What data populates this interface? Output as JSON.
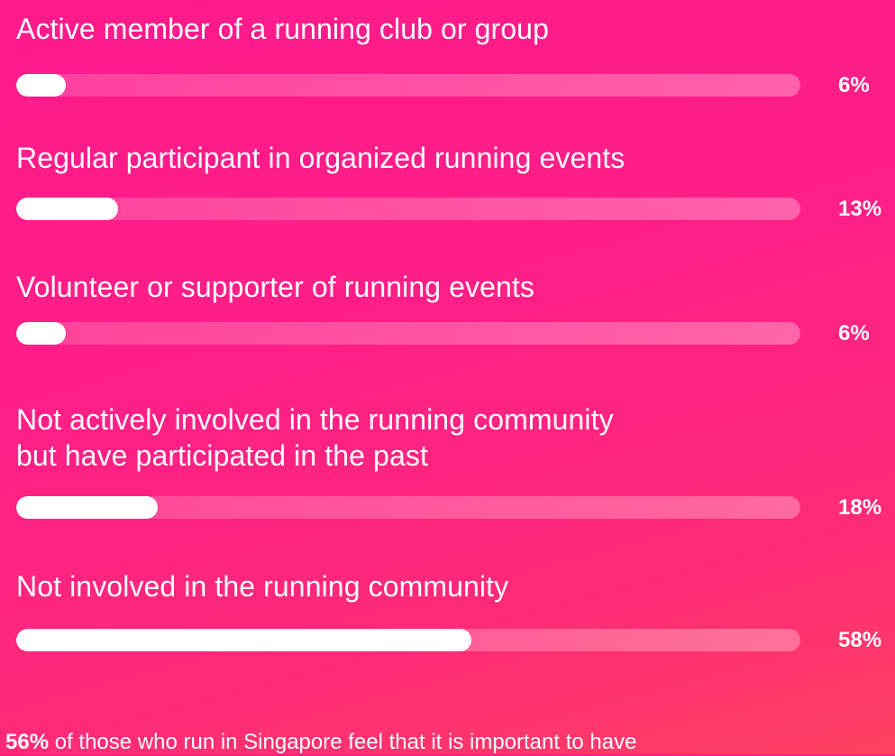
{
  "chart_data": {
    "type": "bar",
    "orientation": "horizontal",
    "xlim": [
      0,
      100
    ],
    "categories": [
      "Active member of a running club or group",
      "Regular participant in organized running events",
      "Volunteer or supporter of running events",
      "Not actively involved in the running community but have participated in the past",
      "Not involved in the running community"
    ],
    "category_lines": [
      [
        "Active member of a running club or group"
      ],
      [
        "Regular participant in organized running events"
      ],
      [
        "Volunteer or supporter of running events"
      ],
      [
        "Not actively involved in the running community",
        "but have participated in the past"
      ],
      [
        "Not involved in the running community"
      ]
    ],
    "values": [
      6,
      13,
      6,
      18,
      58
    ],
    "value_labels": [
      "6%",
      "13%",
      "6%",
      "18%",
      "58%"
    ],
    "colors": {
      "fill": "#ffffff",
      "background": "#ff1a8c"
    }
  },
  "footnote": {
    "highlight": "56%",
    "text": " of those who run in Singapore feel that it is important to have"
  }
}
